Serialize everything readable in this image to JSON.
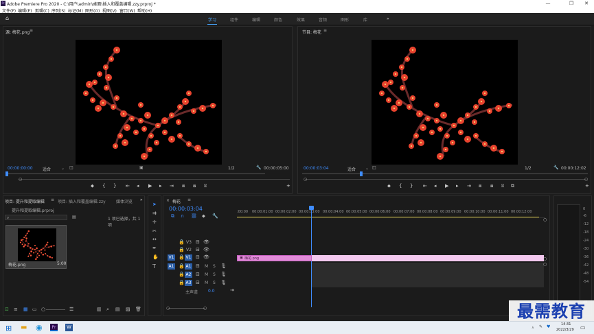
{
  "title": "Adobe Premiere Pro 2020 - C:\\用户\\admin\\桌面\\插入和覆盖编辑.zzy.prproj *",
  "app_icon": "Pr",
  "menu": [
    "文件(F)",
    "编辑(E)",
    "剪辑(C)",
    "序列(S)",
    "标记(M)",
    "图形(G)",
    "视图(V)",
    "窗口(W)",
    "帮助(H)"
  ],
  "workspaces": [
    "学习",
    "组件",
    "编辑",
    "颜色",
    "效果",
    "音频",
    "图形",
    "库"
  ],
  "active_workspace": "学习",
  "source": {
    "title": "源: 梅花.png",
    "time_left": "00:00:00:00",
    "fit": "适合",
    "ratio": "1/2",
    "time_right": "00:00:05:00"
  },
  "program": {
    "title": "节目: 梅花",
    "time_left": "00:00:03:04",
    "fit": "适合",
    "ratio": "1/2",
    "time_right": "00:00:12:02"
  },
  "project": {
    "tab1": "项目: 提升和提取编辑",
    "tab2": "项目: 插入和覆盖编辑.zzy",
    "tab3": "媒体浏览",
    "file": "提升和提取编辑.prproj",
    "selection": "1 项已选择，共 1 项",
    "clip_name": "梅花.png",
    "clip_duration": "5:00"
  },
  "timeline": {
    "seq": "梅花",
    "timecode": "00:00:03:04",
    "ruler": [
      ":00:00",
      "00:00:01:00",
      "00:00:02:00",
      "00:00:03:00",
      "00:00:04:00",
      "00:00:05:00",
      "00:00:06:00",
      "00:00:07:00",
      "00:00:08:00",
      "00:00:09:00",
      "00:00:10:00",
      "00:00:11:00",
      "00:00:12:00"
    ],
    "video_tracks": [
      "V3",
      "V2",
      "V1"
    ],
    "audio_tracks": [
      "A1",
      "A2",
      "A3"
    ],
    "src_v": "V1",
    "src_a": "A1",
    "mix": "主声道",
    "mix_val": "0.0",
    "clip_label": "梅花.png",
    "M": "M",
    "S": "S"
  },
  "taskbar": {
    "time": "14:31",
    "date": "2022/3/29"
  },
  "watermark": "最需教育",
  "colors": {
    "accent": "#3f8dff",
    "clip": "#e18bd8",
    "clip_light": "#f3c9ef",
    "blossom": "#e8432e"
  }
}
